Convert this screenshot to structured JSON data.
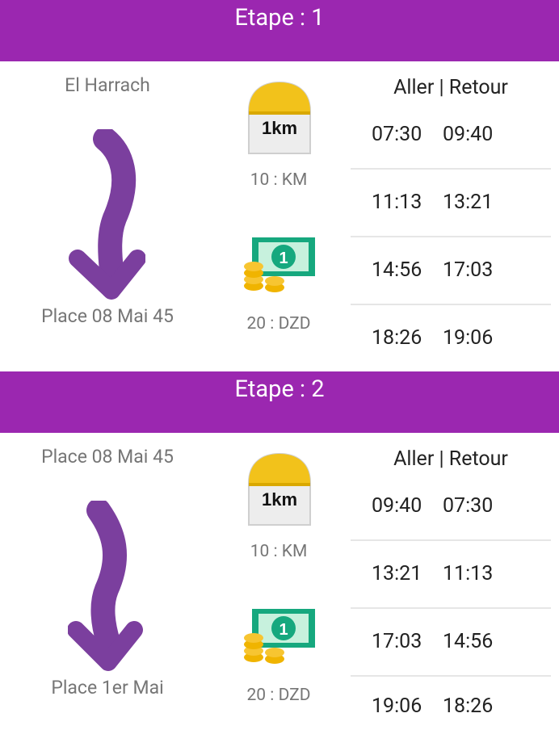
{
  "stages": [
    {
      "title": "Etape : 1",
      "from": "El Harrach",
      "to": "Place 08 Mai 45",
      "distance": "10 : KM",
      "price": "20 : DZD",
      "schedule_header": "Aller | Retour",
      "times": [
        {
          "aller": "07:30",
          "retour": "09:40"
        },
        {
          "aller": "11:13",
          "retour": "13:21"
        },
        {
          "aller": "14:56",
          "retour": "17:03"
        },
        {
          "aller": "18:26",
          "retour": "19:06"
        }
      ]
    },
    {
      "title": "Etape : 2",
      "from": "Place 08 Mai 45",
      "to": "Place 1er Mai",
      "distance": "10 : KM",
      "price": "20 : DZD",
      "schedule_header": "Aller | Retour",
      "times": [
        {
          "aller": "09:40",
          "retour": "07:30"
        },
        {
          "aller": "13:21",
          "retour": "11:13"
        },
        {
          "aller": "17:03",
          "retour": "14:56"
        },
        {
          "aller": "19:06",
          "retour": "18:26"
        }
      ]
    }
  ],
  "icons": {
    "milestone_text": "1km",
    "banknote_text": "1"
  },
  "colors": {
    "header": "#9b27b0",
    "arrow": "#7b3f9e"
  }
}
